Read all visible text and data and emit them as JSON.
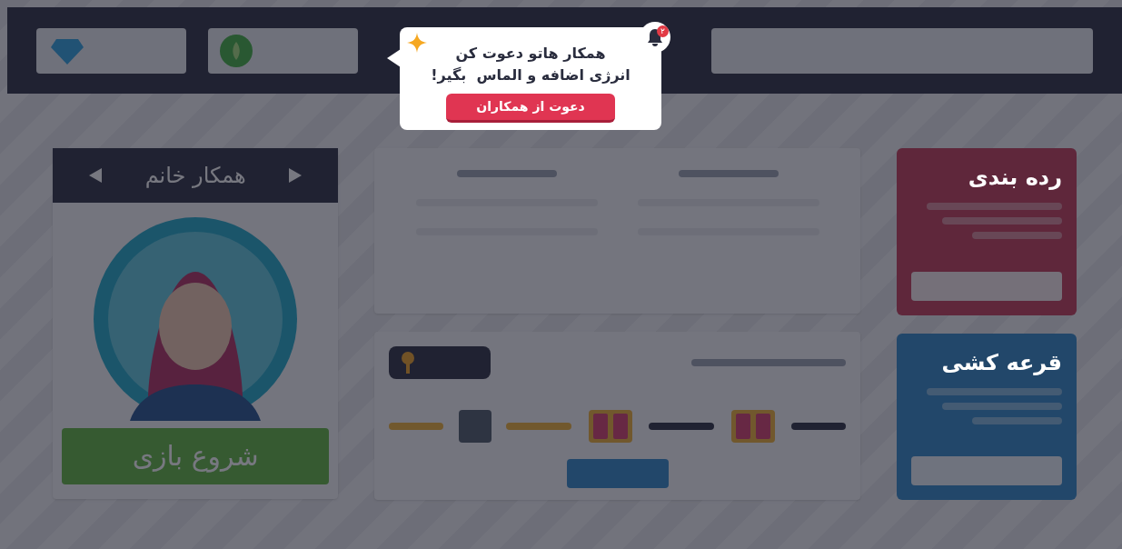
{
  "background": {
    "character_card": {
      "title": "همکار خانم",
      "start_button": "شروع بازی"
    },
    "side_cards": [
      {
        "kind": "ranking",
        "title": "رده بندی"
      },
      {
        "kind": "lottery",
        "title": "قرعه کشی"
      }
    ]
  },
  "popup": {
    "notification_count": "۲",
    "title_lines": [
      "همکار هاتو دعوت کن",
      "انرژی اضافه و الماس  بگیر!"
    ],
    "button": "دعوت از همکاران"
  }
}
